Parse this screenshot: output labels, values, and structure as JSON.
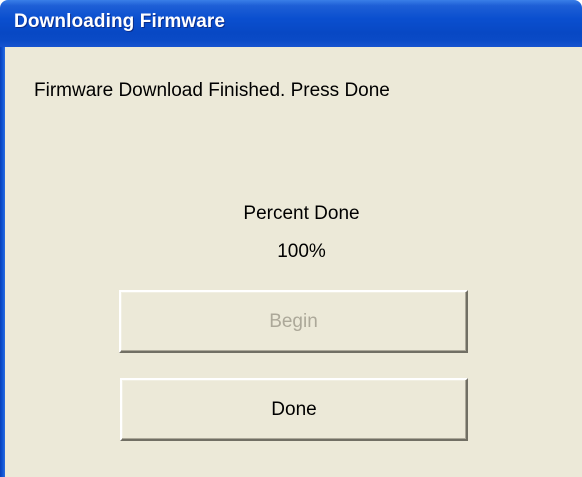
{
  "window": {
    "title": "Downloading Firmware"
  },
  "dialog": {
    "message": "Firmware Download Finished. Press Done",
    "percent_label": "Percent Done",
    "percent_value": "100%",
    "progress": 1.0,
    "begin_label": "Begin",
    "begin_enabled": false,
    "done_label": "Done"
  },
  "colors": {
    "titlebar": "#0a4fcf",
    "client_background": "#ece9d8",
    "disabled_text": "#aca899"
  }
}
